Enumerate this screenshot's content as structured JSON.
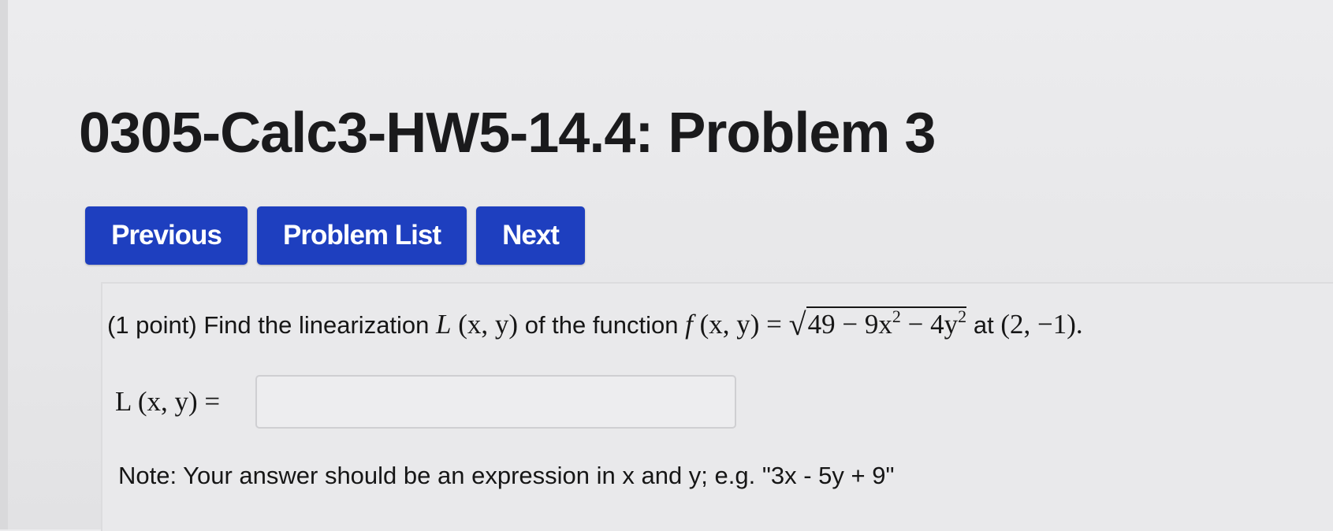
{
  "page": {
    "title": "0305-Calc3-HW5-14.4: Problem 3"
  },
  "nav": {
    "previous_label": "Previous",
    "problem_list_label": "Problem List",
    "next_label": "Next"
  },
  "problem": {
    "points": "(1 point)",
    "text_before": "Find the linearization",
    "L_symbol": "L",
    "vars": "(x, y)",
    "text_middle": "of the function",
    "f_symbol": "f",
    "equals": "=",
    "radicand_a": "49 − 9x",
    "radicand_b": " − 4y",
    "exponent": "2",
    "text_at": "at",
    "point": "(2, −1)."
  },
  "answer": {
    "label": "L (x, y) =",
    "value": "",
    "placeholder": ""
  },
  "note": {
    "text": "Note: Your answer should be an expression in x and y; e.g. \"3x - 5y + 9\""
  }
}
